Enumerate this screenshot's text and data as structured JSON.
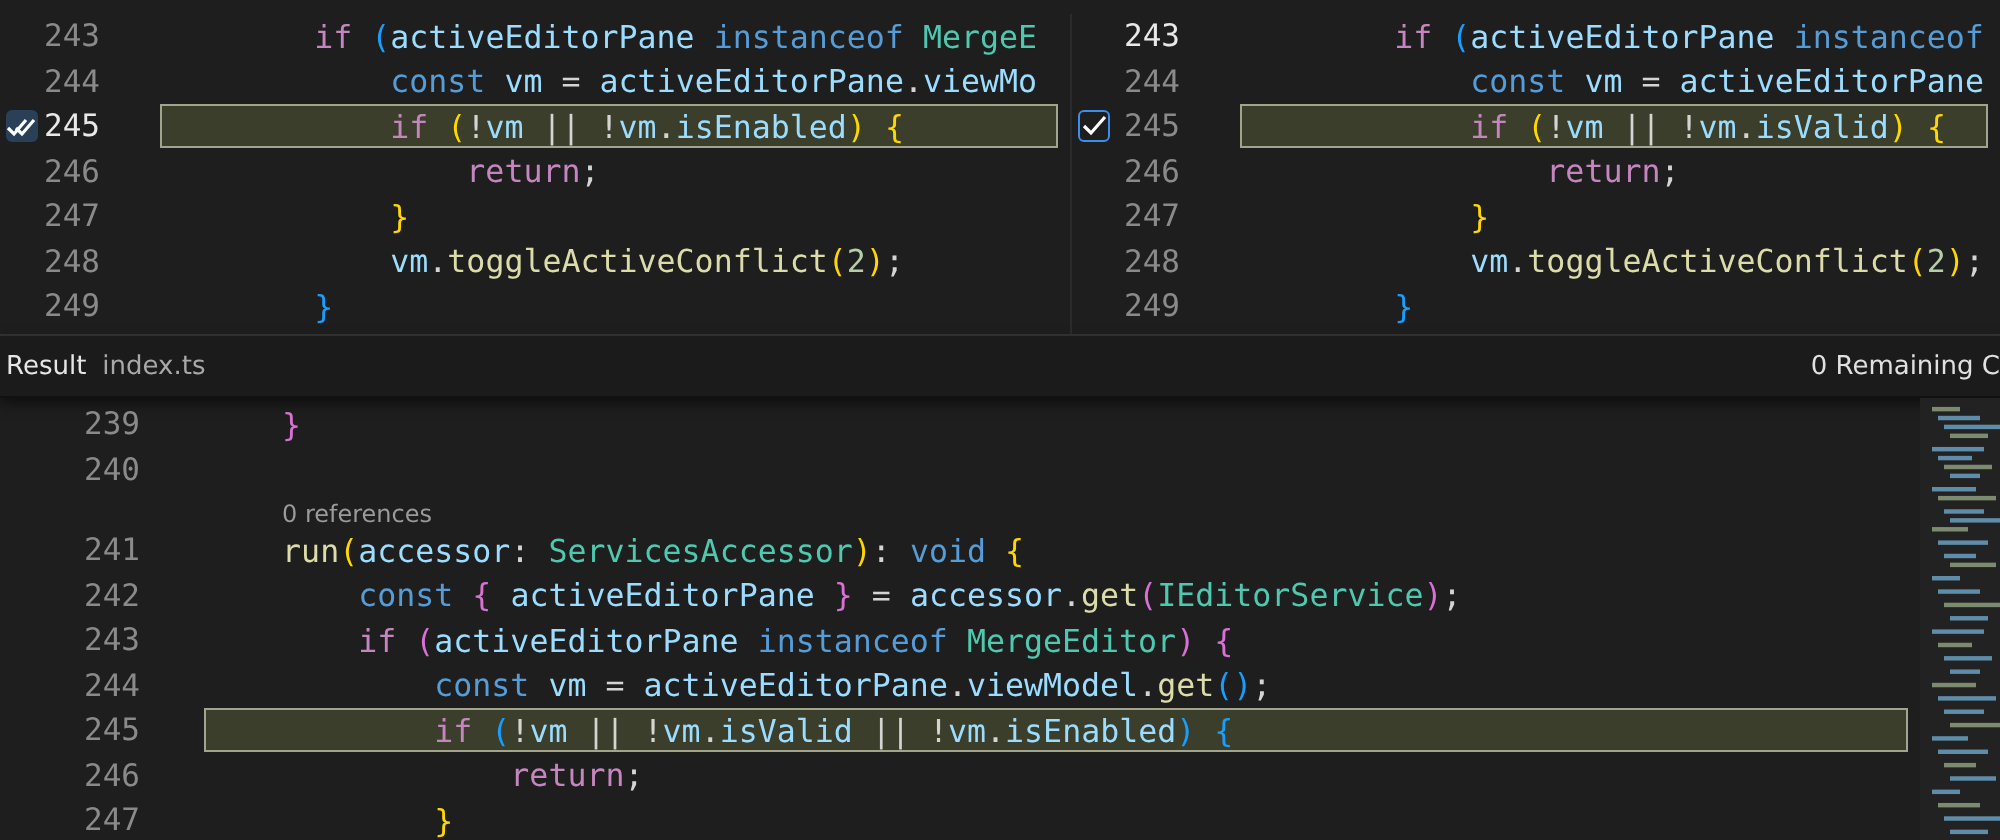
{
  "top_panes": [
    {
      "lines": [
        {
          "number": "243",
          "current": false,
          "highlighted": false,
          "tokens": [
            {
              "kind": "ctrl",
              "text": "        if "
            },
            {
              "kind": "b3",
              "text": "("
            },
            {
              "kind": "var",
              "text": "activeEditorPane "
            },
            {
              "kind": "kw",
              "text": "instanceof "
            },
            {
              "kind": "type",
              "text": "MergeE"
            }
          ]
        },
        {
          "number": "244",
          "current": false,
          "highlighted": false,
          "tokens": [
            {
              "kind": "kw",
              "text": "            const "
            },
            {
              "kind": "var",
              "text": "vm"
            },
            {
              "kind": "p",
              "text": " = "
            },
            {
              "kind": "var",
              "text": "activeEditorPane"
            },
            {
              "kind": "p",
              "text": "."
            },
            {
              "kind": "var",
              "text": "viewMo"
            }
          ]
        },
        {
          "number": "245",
          "current": true,
          "highlighted": true,
          "marker": {
            "kind": "double-check",
            "checked": true
          },
          "tokens": [
            {
              "kind": "ctrl",
              "text": "            if "
            },
            {
              "kind": "b1",
              "text": "("
            },
            {
              "kind": "p",
              "text": "!"
            },
            {
              "kind": "var",
              "text": "vm"
            },
            {
              "kind": "p",
              "text": " || !"
            },
            {
              "kind": "var",
              "text": "vm"
            },
            {
              "kind": "p",
              "text": "."
            },
            {
              "kind": "var",
              "text": "isEnabled"
            },
            {
              "kind": "b1",
              "text": ") {"
            }
          ]
        },
        {
          "number": "246",
          "current": false,
          "highlighted": false,
          "tokens": [
            {
              "kind": "ctrl",
              "text": "                return"
            },
            {
              "kind": "p",
              "text": ";"
            }
          ]
        },
        {
          "number": "247",
          "current": false,
          "highlighted": false,
          "tokens": [
            {
              "kind": "b1",
              "text": "            }"
            }
          ]
        },
        {
          "number": "248",
          "current": false,
          "highlighted": false,
          "tokens": [
            {
              "kind": "var",
              "text": "            vm"
            },
            {
              "kind": "p",
              "text": "."
            },
            {
              "kind": "func",
              "text": "toggleActiveConflict"
            },
            {
              "kind": "b1",
              "text": "("
            },
            {
              "kind": "num",
              "text": "2"
            },
            {
              "kind": "b1",
              "text": ")"
            },
            {
              "kind": "p",
              "text": ";"
            }
          ]
        },
        {
          "number": "249",
          "current": false,
          "highlighted": false,
          "tokens": [
            {
              "kind": "b3",
              "text": "        }"
            }
          ]
        }
      ]
    },
    {
      "lines": [
        {
          "number": "243",
          "current": true,
          "highlighted": false,
          "tokens": [
            {
              "kind": "ctrl",
              "text": "        if "
            },
            {
              "kind": "b3",
              "text": "("
            },
            {
              "kind": "var",
              "text": "activeEditorPane "
            },
            {
              "kind": "kw",
              "text": "instanceof"
            }
          ]
        },
        {
          "number": "244",
          "current": false,
          "highlighted": false,
          "tokens": [
            {
              "kind": "kw",
              "text": "            const "
            },
            {
              "kind": "var",
              "text": "vm"
            },
            {
              "kind": "p",
              "text": " = "
            },
            {
              "kind": "var",
              "text": "activeEditorPane"
            }
          ]
        },
        {
          "number": "245",
          "current": false,
          "highlighted": true,
          "marker": {
            "kind": "checkbox",
            "checked": true
          },
          "tokens": [
            {
              "kind": "ctrl",
              "text": "            if "
            },
            {
              "kind": "b1",
              "text": "("
            },
            {
              "kind": "p",
              "text": "!"
            },
            {
              "kind": "var",
              "text": "vm"
            },
            {
              "kind": "p",
              "text": " || !"
            },
            {
              "kind": "var",
              "text": "vm"
            },
            {
              "kind": "p",
              "text": "."
            },
            {
              "kind": "var",
              "text": "isValid"
            },
            {
              "kind": "b1",
              "text": ") {"
            }
          ]
        },
        {
          "number": "246",
          "current": false,
          "highlighted": false,
          "tokens": [
            {
              "kind": "ctrl",
              "text": "                return"
            },
            {
              "kind": "p",
              "text": ";"
            }
          ]
        },
        {
          "number": "247",
          "current": false,
          "highlighted": false,
          "tokens": [
            {
              "kind": "b1",
              "text": "            }"
            }
          ]
        },
        {
          "number": "248",
          "current": false,
          "highlighted": false,
          "tokens": [
            {
              "kind": "var",
              "text": "            vm"
            },
            {
              "kind": "p",
              "text": "."
            },
            {
              "kind": "func",
              "text": "toggleActiveConflict"
            },
            {
              "kind": "b1",
              "text": "("
            },
            {
              "kind": "num",
              "text": "2"
            },
            {
              "kind": "b1",
              "text": ")"
            },
            {
              "kind": "p",
              "text": ";"
            }
          ]
        },
        {
          "number": "249",
          "current": false,
          "highlighted": false,
          "tokens": [
            {
              "kind": "b3",
              "text": "        }"
            }
          ]
        }
      ]
    }
  ],
  "result_header": {
    "title": "Result",
    "file": "index.ts",
    "status": "0 Remaining C"
  },
  "result_editor": {
    "lines": [
      {
        "kind": "code",
        "number": "239",
        "current": false,
        "highlighted": false,
        "tokens": [
          {
            "kind": "b2",
            "text": "    }"
          }
        ]
      },
      {
        "kind": "code",
        "number": "240",
        "current": false,
        "highlighted": false
      },
      {
        "kind": "codelens",
        "text": "0 references"
      },
      {
        "kind": "code",
        "number": "241",
        "current": false,
        "highlighted": false,
        "tokens": [
          {
            "kind": "func",
            "text": "    run"
          },
          {
            "kind": "b1",
            "text": "("
          },
          {
            "kind": "var",
            "text": "accessor"
          },
          {
            "kind": "p",
            "text": ": "
          },
          {
            "kind": "type",
            "text": "ServicesAccessor"
          },
          {
            "kind": "b1",
            "text": ")"
          },
          {
            "kind": "p",
            "text": ": "
          },
          {
            "kind": "kw",
            "text": "void "
          },
          {
            "kind": "b1",
            "text": "{"
          }
        ]
      },
      {
        "kind": "code",
        "number": "242",
        "current": false,
        "highlighted": false,
        "tokens": [
          {
            "kind": "kw",
            "text": "        const "
          },
          {
            "kind": "b2",
            "text": "{ "
          },
          {
            "kind": "var",
            "text": "activeEditorPane "
          },
          {
            "kind": "b2",
            "text": "}"
          },
          {
            "kind": "p",
            "text": " = "
          },
          {
            "kind": "var",
            "text": "accessor"
          },
          {
            "kind": "p",
            "text": "."
          },
          {
            "kind": "func",
            "text": "get"
          },
          {
            "kind": "b2",
            "text": "("
          },
          {
            "kind": "type",
            "text": "IEditorService"
          },
          {
            "kind": "b2",
            "text": ")"
          },
          {
            "kind": "p",
            "text": ";"
          }
        ]
      },
      {
        "kind": "code",
        "number": "243",
        "current": false,
        "highlighted": false,
        "tokens": [
          {
            "kind": "ctrl",
            "text": "        if "
          },
          {
            "kind": "b2",
            "text": "("
          },
          {
            "kind": "var",
            "text": "activeEditorPane "
          },
          {
            "kind": "kw",
            "text": "instanceof "
          },
          {
            "kind": "type",
            "text": "MergeEditor"
          },
          {
            "kind": "b2",
            "text": ") {"
          }
        ]
      },
      {
        "kind": "code",
        "number": "244",
        "current": false,
        "highlighted": false,
        "tokens": [
          {
            "kind": "kw",
            "text": "            const "
          },
          {
            "kind": "var",
            "text": "vm"
          },
          {
            "kind": "p",
            "text": " = "
          },
          {
            "kind": "var",
            "text": "activeEditorPane"
          },
          {
            "kind": "p",
            "text": "."
          },
          {
            "kind": "var",
            "text": "viewModel"
          },
          {
            "kind": "p",
            "text": "."
          },
          {
            "kind": "func",
            "text": "get"
          },
          {
            "kind": "b3",
            "text": "()"
          },
          {
            "kind": "p",
            "text": ";"
          }
        ]
      },
      {
        "kind": "code",
        "number": "245",
        "current": false,
        "highlighted": true,
        "tokens": [
          {
            "kind": "ctrl",
            "text": "            if "
          },
          {
            "kind": "b3",
            "text": "("
          },
          {
            "kind": "p",
            "text": "!"
          },
          {
            "kind": "var",
            "text": "vm"
          },
          {
            "kind": "p",
            "text": " || !"
          },
          {
            "kind": "var",
            "text": "vm"
          },
          {
            "kind": "p",
            "text": "."
          },
          {
            "kind": "var",
            "text": "isValid"
          },
          {
            "kind": "p",
            "text": " || !"
          },
          {
            "kind": "var",
            "text": "vm"
          },
          {
            "kind": "p",
            "text": "."
          },
          {
            "kind": "var",
            "text": "isEnabled"
          },
          {
            "kind": "b3",
            "text": ") {"
          }
        ]
      },
      {
        "kind": "code",
        "number": "246",
        "current": false,
        "highlighted": false,
        "tokens": [
          {
            "kind": "ctrl",
            "text": "                return"
          },
          {
            "kind": "p",
            "text": ";"
          }
        ]
      },
      {
        "kind": "code",
        "number": "247",
        "current": false,
        "highlighted": false,
        "tokens": [
          {
            "kind": "b1",
            "text": "            }"
          }
        ]
      }
    ]
  }
}
